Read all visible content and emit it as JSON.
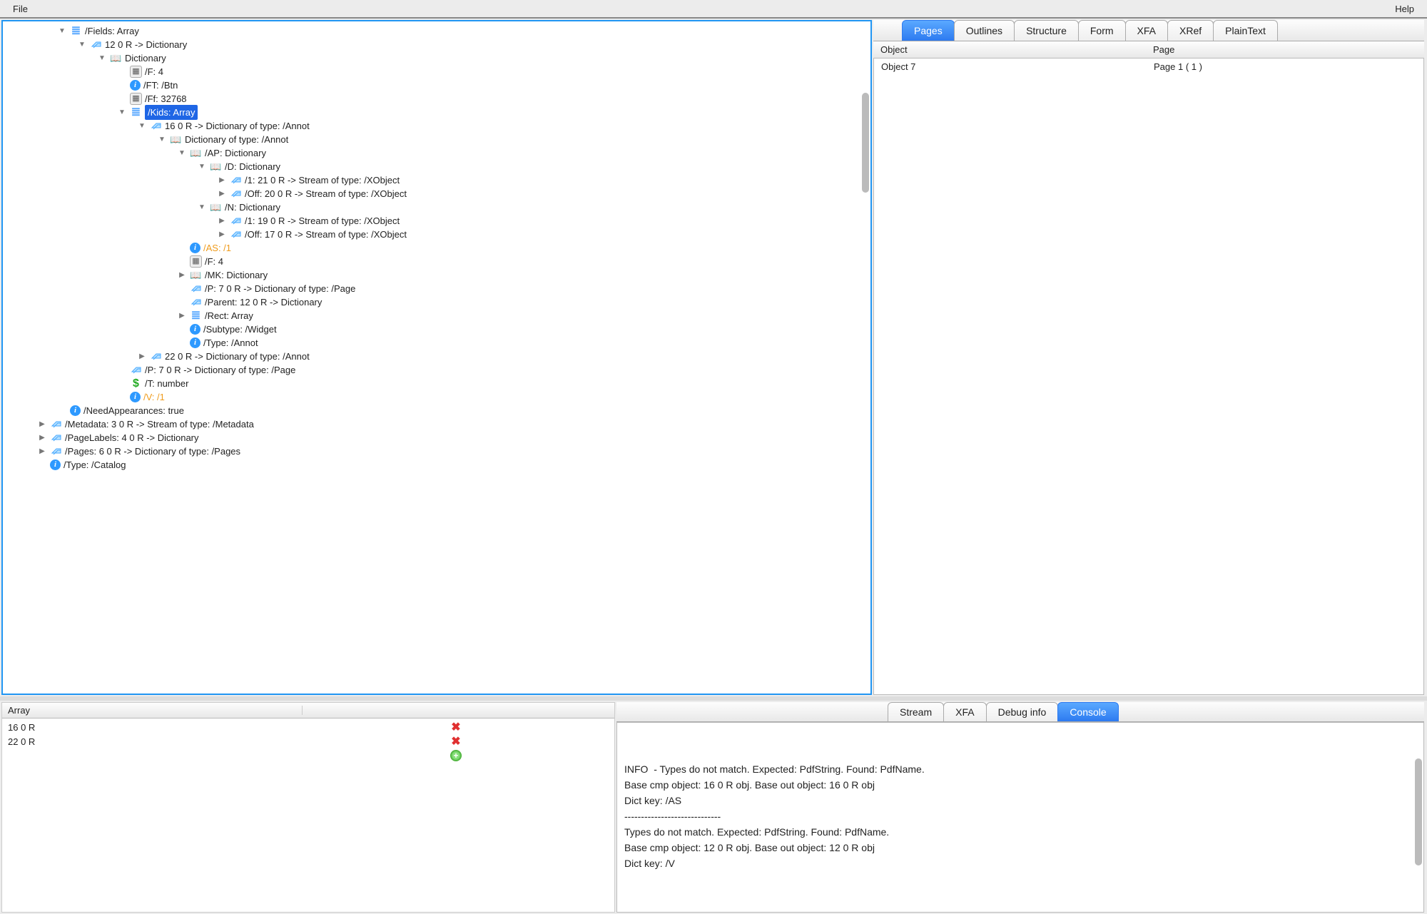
{
  "menubar": {
    "file": "File",
    "help": "Help"
  },
  "tree": {
    "nodes": [
      {
        "indent": 2,
        "disclosure": "down",
        "icon": "array",
        "label": "/Fields: Array",
        "style": ""
      },
      {
        "indent": 3,
        "disclosure": "down",
        "icon": "ref",
        "label": "12 0 R -> Dictionary",
        "style": ""
      },
      {
        "indent": 4,
        "disclosure": "down",
        "icon": "book",
        "label": "Dictionary",
        "style": ""
      },
      {
        "indent": 5,
        "disclosure": "none",
        "icon": "calc",
        "label": "/F: 4",
        "style": ""
      },
      {
        "indent": 5,
        "disclosure": "none",
        "icon": "info",
        "label": "/FT: /Btn",
        "style": ""
      },
      {
        "indent": 5,
        "disclosure": "none",
        "icon": "calc",
        "label": "/Ff: 32768",
        "style": ""
      },
      {
        "indent": 5,
        "disclosure": "down",
        "icon": "array",
        "label": "/Kids: Array",
        "style": "highlight"
      },
      {
        "indent": 6,
        "disclosure": "down",
        "icon": "ref",
        "label": "16 0 R -> Dictionary of type: /Annot",
        "style": ""
      },
      {
        "indent": 7,
        "disclosure": "down",
        "icon": "book",
        "label": "Dictionary of type: /Annot",
        "style": ""
      },
      {
        "indent": 8,
        "disclosure": "down",
        "icon": "book",
        "label": "/AP: Dictionary",
        "style": ""
      },
      {
        "indent": 9,
        "disclosure": "down",
        "icon": "book",
        "label": "/D: Dictionary",
        "style": ""
      },
      {
        "indent": 10,
        "disclosure": "right",
        "icon": "ref",
        "label": "/1: 21 0 R -> Stream of type: /XObject",
        "style": ""
      },
      {
        "indent": 10,
        "disclosure": "right",
        "icon": "ref",
        "label": "/Off: 20 0 R -> Stream of type: /XObject",
        "style": ""
      },
      {
        "indent": 9,
        "disclosure": "down",
        "icon": "book",
        "label": "/N: Dictionary",
        "style": ""
      },
      {
        "indent": 10,
        "disclosure": "right",
        "icon": "ref",
        "label": "/1: 19 0 R -> Stream of type: /XObject",
        "style": ""
      },
      {
        "indent": 10,
        "disclosure": "right",
        "icon": "ref",
        "label": "/Off: 17 0 R -> Stream of type: /XObject",
        "style": ""
      },
      {
        "indent": 8,
        "disclosure": "none",
        "icon": "info",
        "label": "/AS: /1",
        "style": "orange"
      },
      {
        "indent": 8,
        "disclosure": "none",
        "icon": "calc",
        "label": "/F: 4",
        "style": ""
      },
      {
        "indent": 8,
        "disclosure": "right",
        "icon": "book",
        "label": "/MK: Dictionary",
        "style": ""
      },
      {
        "indent": 8,
        "disclosure": "none",
        "icon": "ref",
        "label": "/P: 7 0 R -> Dictionary of type: /Page",
        "style": ""
      },
      {
        "indent": 8,
        "disclosure": "none",
        "icon": "ref",
        "label": "/Parent: 12 0 R -> Dictionary",
        "style": ""
      },
      {
        "indent": 8,
        "disclosure": "right",
        "icon": "array",
        "label": "/Rect: Array",
        "style": ""
      },
      {
        "indent": 8,
        "disclosure": "none",
        "icon": "info",
        "label": "/Subtype: /Widget",
        "style": ""
      },
      {
        "indent": 8,
        "disclosure": "none",
        "icon": "info",
        "label": "/Type: /Annot",
        "style": ""
      },
      {
        "indent": 6,
        "disclosure": "right",
        "icon": "ref",
        "label": "22 0 R -> Dictionary of type: /Annot",
        "style": ""
      },
      {
        "indent": 5,
        "disclosure": "none",
        "icon": "ref",
        "label": "/P: 7 0 R -> Dictionary of type: /Page",
        "style": ""
      },
      {
        "indent": 5,
        "disclosure": "none",
        "icon": "dollar",
        "label": "/T: number",
        "style": ""
      },
      {
        "indent": 5,
        "disclosure": "none",
        "icon": "info",
        "label": "/V: /1",
        "style": "orange"
      },
      {
        "indent": 2,
        "disclosure": "none",
        "icon": "info",
        "label": "/NeedAppearances: true",
        "style": ""
      },
      {
        "indent": 1,
        "disclosure": "right",
        "icon": "ref",
        "label": "/Metadata: 3 0 R -> Stream of type: /Metadata",
        "style": ""
      },
      {
        "indent": 1,
        "disclosure": "right",
        "icon": "ref",
        "label": "/PageLabels: 4 0 R -> Dictionary",
        "style": ""
      },
      {
        "indent": 1,
        "disclosure": "right",
        "icon": "ref",
        "label": "/Pages: 6 0 R -> Dictionary of type: /Pages",
        "style": ""
      },
      {
        "indent": 1,
        "disclosure": "none",
        "icon": "info",
        "label": "/Type: /Catalog",
        "style": ""
      }
    ]
  },
  "rightTabs": {
    "tabs": [
      "Pages",
      "Outlines",
      "Structure",
      "Form",
      "XFA",
      "XRef",
      "PlainText"
    ],
    "active": "Pages",
    "columns": {
      "object": "Object",
      "page": "Page"
    },
    "rows": [
      {
        "object": "Object 7",
        "page": "Page 1 ( 1 )"
      }
    ]
  },
  "arrayPanel": {
    "header": "Array",
    "rows": [
      {
        "label": "16 0 R",
        "action": "delete"
      },
      {
        "label": "22 0 R",
        "action": "delete"
      },
      {
        "label": "",
        "action": "add"
      }
    ]
  },
  "consoleTabs": {
    "tabs": [
      "Stream",
      "XFA",
      "Debug info",
      "Console"
    ],
    "active": "Console"
  },
  "consoleText": "\nINFO  - Types do not match. Expected: PdfString. Found: PdfName.\nBase cmp object: 16 0 R obj. Base out object: 16 0 R obj\nDict key: /AS\n-----------------------------\nTypes do not match. Expected: PdfString. Found: PdfName.\nBase cmp object: 12 0 R obj. Base out object: 12 0 R obj\nDict key: /V"
}
